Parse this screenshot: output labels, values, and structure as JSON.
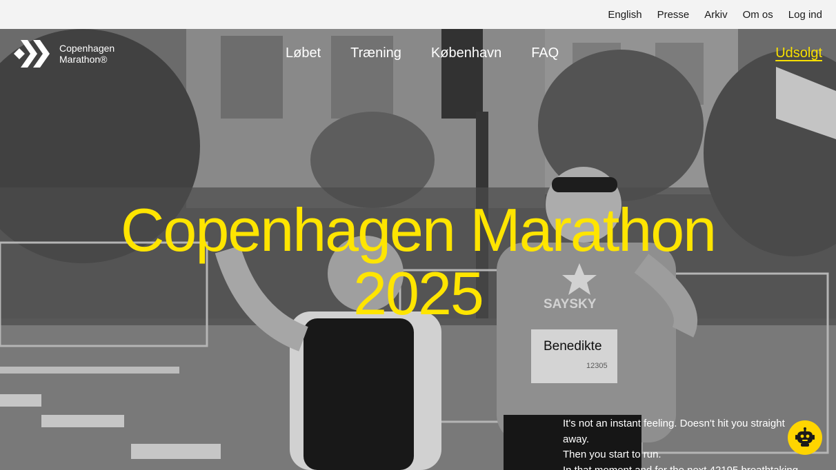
{
  "utility_nav": {
    "items": [
      "English",
      "Presse",
      "Arkiv",
      "Om os",
      "Log ind"
    ]
  },
  "brand": {
    "line1": "Copenhagen",
    "line2": "Marathon®"
  },
  "main_nav": {
    "items": [
      "Løbet",
      "Træning",
      "København",
      "FAQ"
    ]
  },
  "cta": {
    "label": "Udsolgt"
  },
  "hero": {
    "title_line1": "Copenhagen Marathon",
    "title_line2": "2025",
    "bib_name": "Benedikte",
    "bib_number": "12305",
    "shirt_text": "SAYSKY",
    "intro_lines": [
      "It's not an instant feeling. Doesn't hit you straight",
      "away.",
      "Then you start to run.",
      "In that moment and for the next 42195 breathtaking"
    ]
  },
  "colors": {
    "accent": "#ffe500",
    "bot": "#ffd500",
    "utility_bg": "#f3f3f3"
  },
  "icons": {
    "logo": "brand-chevron-logo",
    "chat": "robot-chat-icon"
  }
}
